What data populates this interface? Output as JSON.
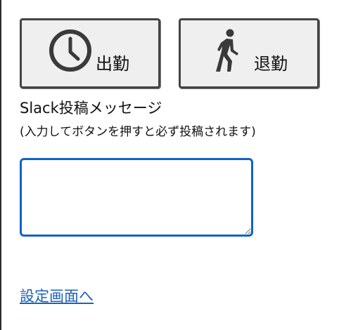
{
  "buttons": {
    "checkin": {
      "label": "出勤",
      "icon": "clock-icon"
    },
    "checkout": {
      "label": "退勤",
      "icon": "walking-person-icon"
    }
  },
  "slack": {
    "title": "Slack投稿メッセージ",
    "note": "(入力してボタンを押すと必ず投稿されます)",
    "input_value": ""
  },
  "links": {
    "settings": "設定画面へ"
  },
  "colors": {
    "input_focus_border": "#1063c7",
    "link": "#1a63b8",
    "button_border": "#444444",
    "button_bg": "#efefef"
  }
}
